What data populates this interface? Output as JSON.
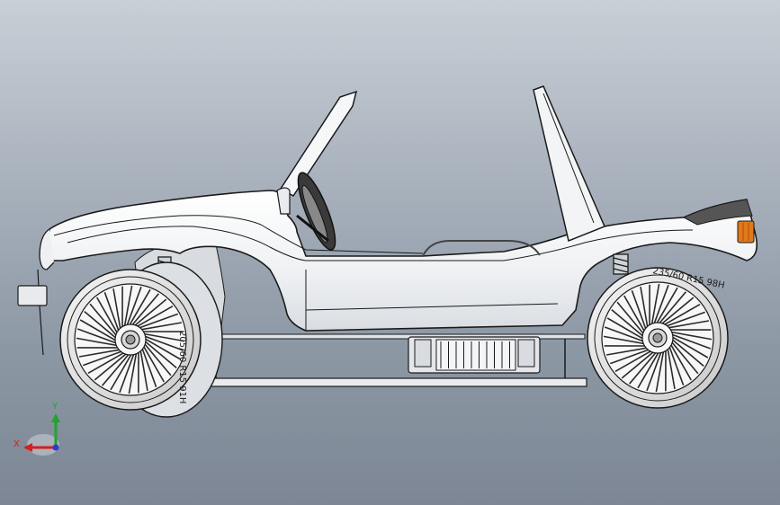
{
  "viewport": {
    "background_top": "#c9cfd6",
    "background_bottom": "#7c8694"
  },
  "model": {
    "body_color": "#f2f3f6",
    "outline_color": "#1a1a1a",
    "tire_color": "#e6e6e6",
    "spoke_color": "#2b2b2b",
    "brake_color": "#2f8a3a",
    "taillight_color": "#e07a1a",
    "tire_sidewall_text_front": "205/60 R15 91H",
    "tire_sidewall_text_rear": "235/60 R15 98H"
  },
  "triad": {
    "x_label": "X",
    "y_label": "Y",
    "x_color": "#d41f1f",
    "y_color": "#1ea52a",
    "z_color": "#2a3bd6"
  }
}
